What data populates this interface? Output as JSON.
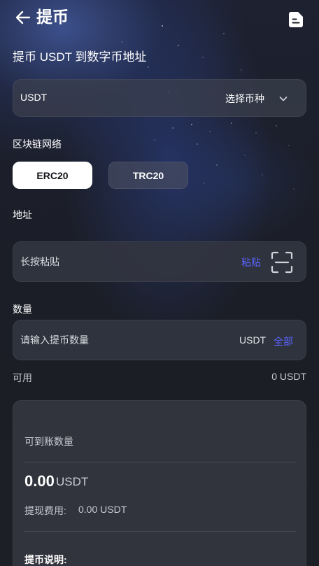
{
  "header": {
    "title": "提币"
  },
  "form": {
    "section_title": "提币 USDT 到数字币地址",
    "coin": {
      "selected": "USDT",
      "hint": "选择币种"
    },
    "network": {
      "label": "区块链网络",
      "options": [
        "ERC20",
        "TRC20"
      ],
      "selected": "ERC20"
    },
    "address": {
      "label": "地址",
      "placeholder": "长按粘贴",
      "value": "",
      "paste_label": "粘贴"
    },
    "amount": {
      "label": "数量",
      "placeholder": "请输入提币数量",
      "value": "",
      "unit": "USDT",
      "all_label": "全部"
    },
    "available": {
      "label": "可用",
      "value": "0 USDT"
    }
  },
  "summary": {
    "receive_label": "可到账数量",
    "receive_amount": "0.00",
    "receive_unit": "USDT",
    "fee_label": "提现费用:",
    "fee_value": "0.00 USDT",
    "note_title": "提币说明:"
  },
  "colors": {
    "accent": "#5b63ff",
    "background": "#1b1d24",
    "card": "#32343d",
    "active_chip": "#ffffff"
  }
}
